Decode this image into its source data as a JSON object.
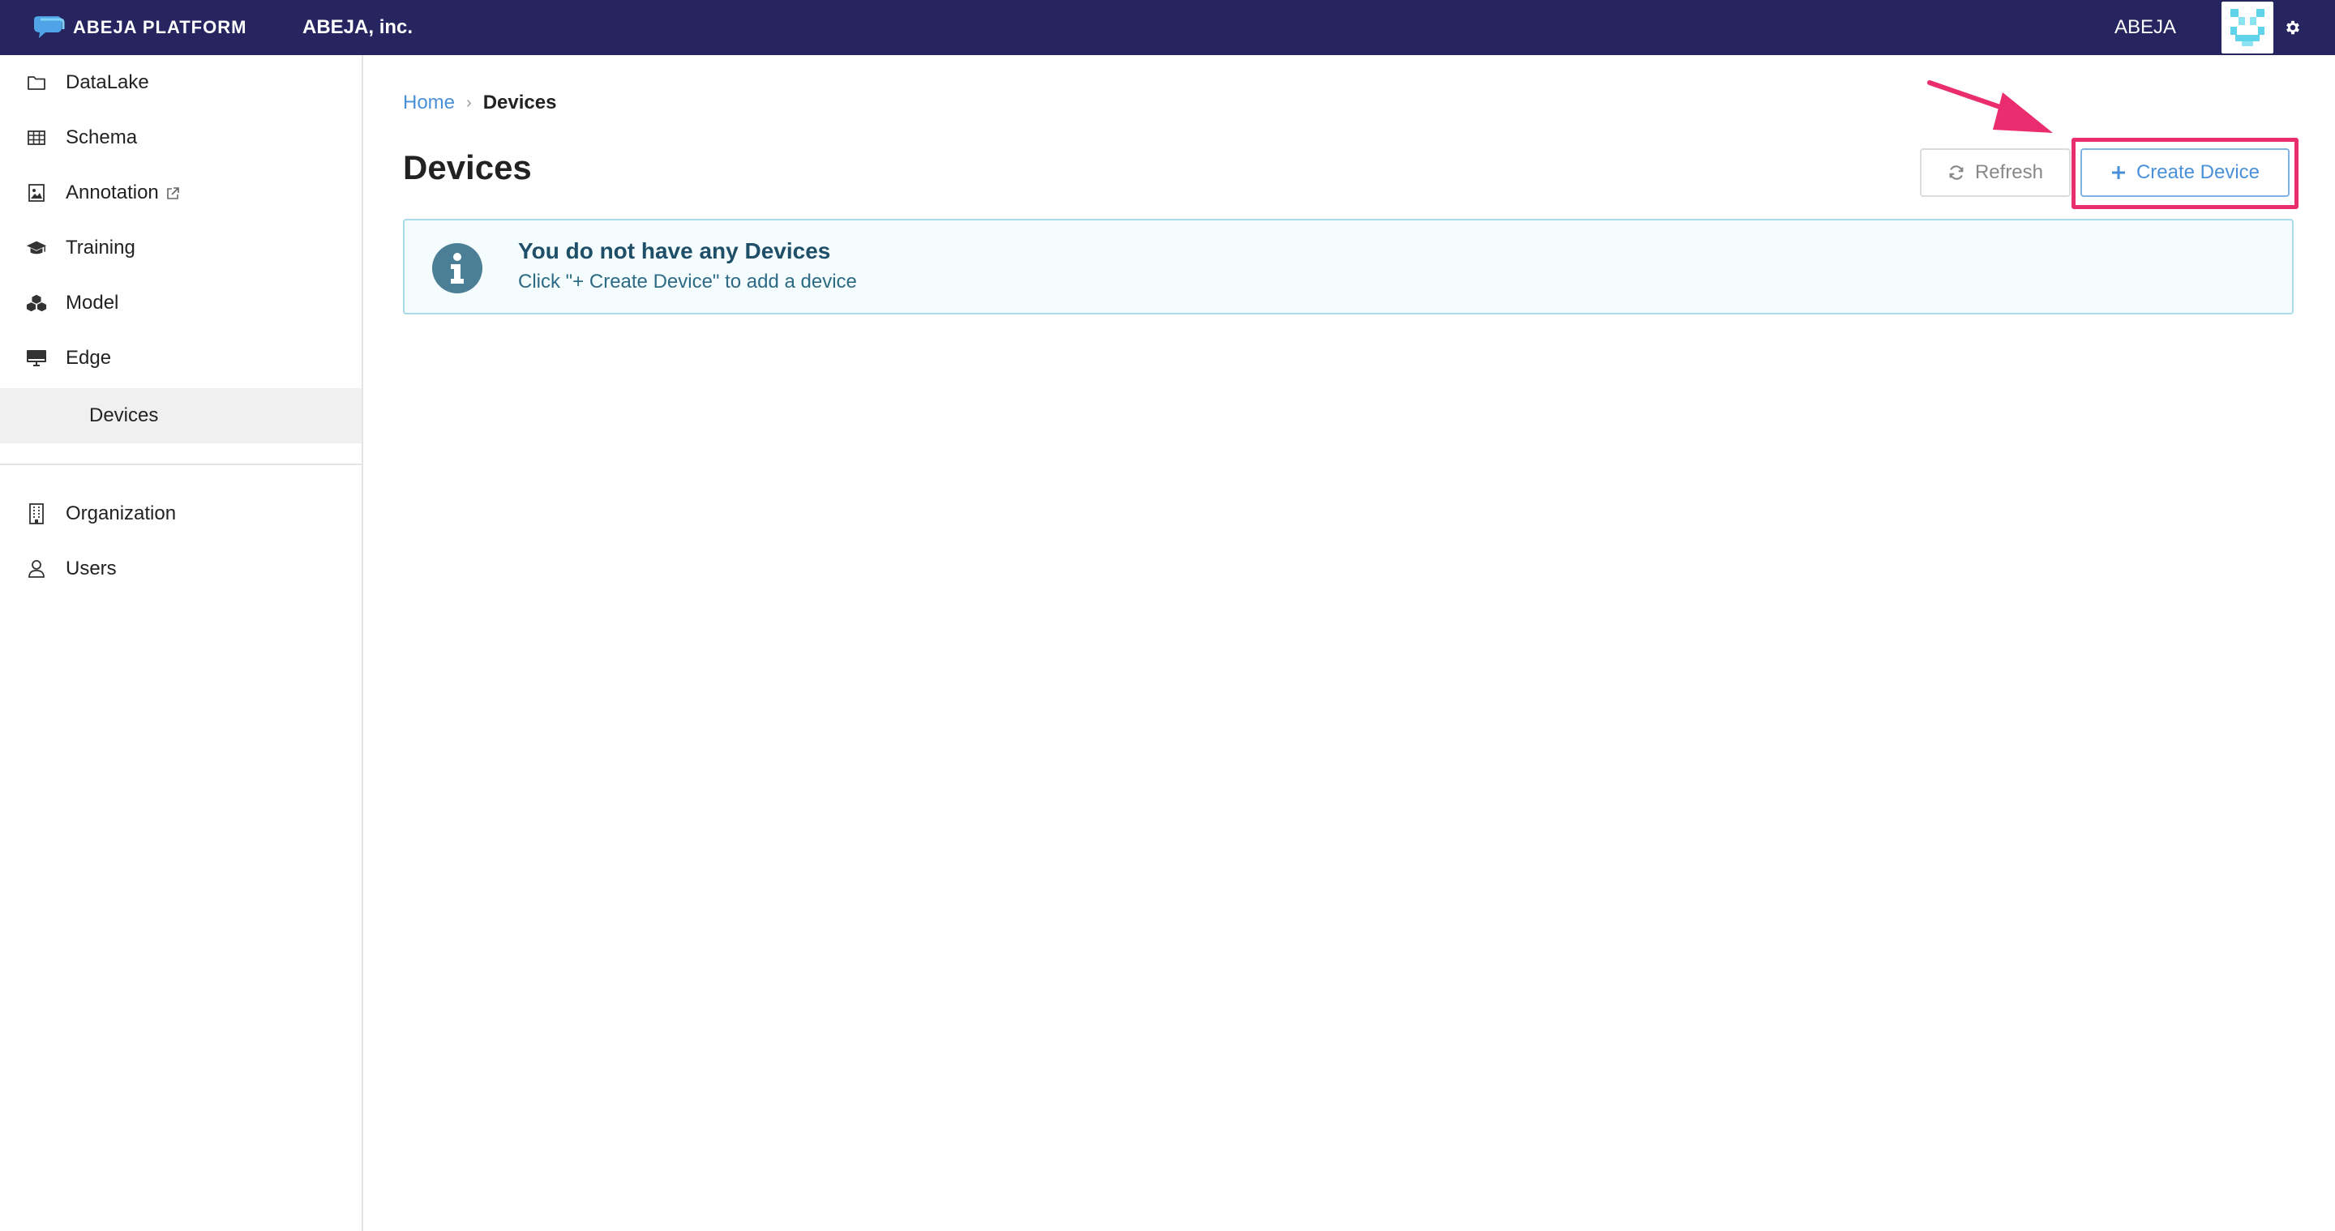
{
  "header": {
    "brand": "ABEJA PLATFORM",
    "org": "ABEJA, inc.",
    "user": "ABEJA",
    "colors": {
      "bar": "#262560",
      "accent": "#ea2d6f"
    }
  },
  "sidebar": {
    "items": [
      {
        "label": "DataLake",
        "icon": "folder-icon"
      },
      {
        "label": "Schema",
        "icon": "table-icon"
      },
      {
        "label": "Annotation",
        "icon": "image-icon",
        "external": true
      },
      {
        "label": "Training",
        "icon": "graduation-cap-icon"
      },
      {
        "label": "Model",
        "icon": "cubes-icon"
      },
      {
        "label": "Edge",
        "icon": "desktop-icon"
      }
    ],
    "sub_items": [
      {
        "label": "Devices",
        "selected": true
      }
    ],
    "bottom_items": [
      {
        "label": "Organization",
        "icon": "building-icon"
      },
      {
        "label": "Users",
        "icon": "user-icon"
      }
    ]
  },
  "breadcrumb": {
    "home": "Home",
    "separator": "›",
    "current": "Devices"
  },
  "main": {
    "title": "Devices",
    "refresh_label": "Refresh",
    "create_label": "Create Device",
    "empty_title": "You do not have any Devices",
    "empty_subtitle": "Click \"+ Create Device\" to add a device"
  }
}
